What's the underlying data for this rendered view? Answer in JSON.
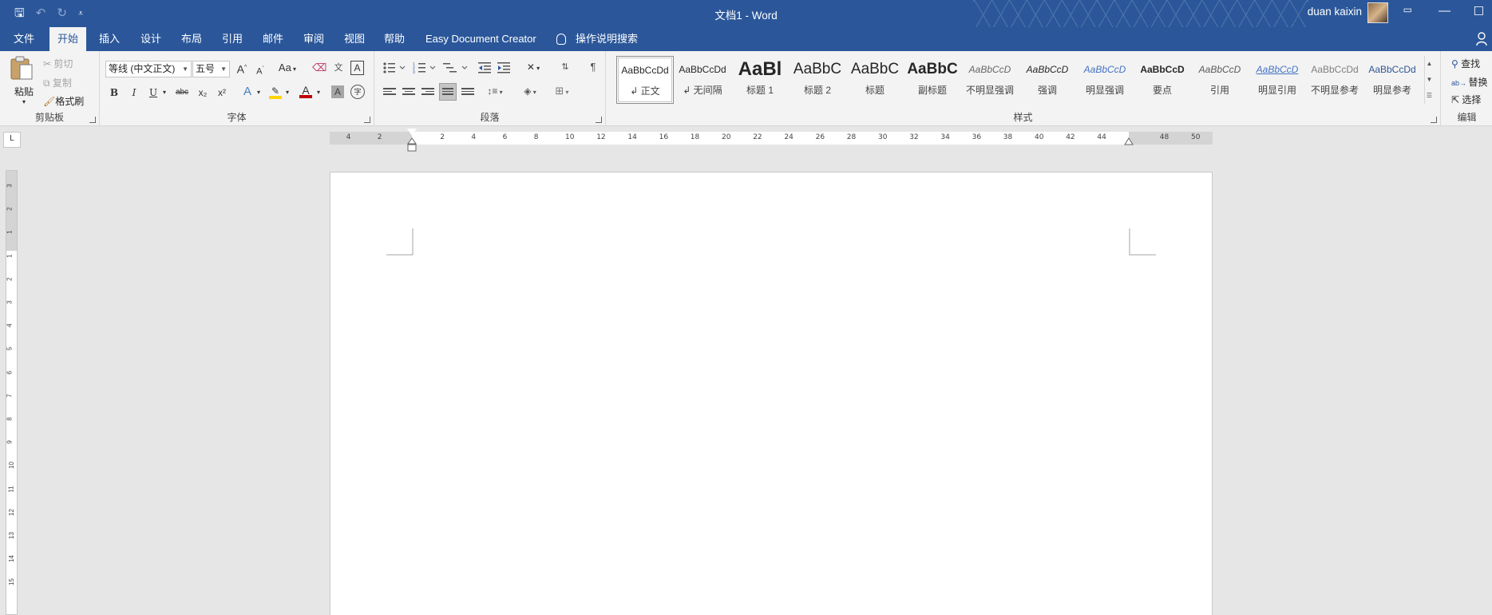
{
  "window": {
    "title": "文档1  -  Word",
    "user": "duan kaixin"
  },
  "quick_access": {
    "save": "🖫",
    "undo": "↶",
    "redo": "↻",
    "customize": "⩡"
  },
  "tabs": [
    {
      "label": "文件"
    },
    {
      "label": "开始"
    },
    {
      "label": "插入"
    },
    {
      "label": "设计"
    },
    {
      "label": "布局"
    },
    {
      "label": "引用"
    },
    {
      "label": "邮件"
    },
    {
      "label": "审阅"
    },
    {
      "label": "视图"
    },
    {
      "label": "帮助"
    },
    {
      "label": "Easy Document Creator"
    }
  ],
  "tell_me": "操作说明搜索",
  "clipboard": {
    "paste": "粘贴",
    "cut": "剪切",
    "copy": "复制",
    "format_painter": "格式刷",
    "group_label": "剪贴板"
  },
  "font": {
    "family": "等线 (中文正文)",
    "size": "五号",
    "group_label": "字体",
    "grow": "A",
    "shrink": "A",
    "case": "Aa",
    "bold": "B",
    "italic": "I",
    "underline": "U",
    "strike": "abc",
    "subscript": "x₂",
    "superscript": "x²",
    "phonetic": "文",
    "char_border": "A",
    "char_shading": "A",
    "enclose": "字"
  },
  "paragraph": {
    "group_label": "段落"
  },
  "styles": {
    "group_label": "样式",
    "items": [
      {
        "sample": "AaBbCcDd",
        "name": "↲ 正文"
      },
      {
        "sample": "AaBbCcDd",
        "name": "↲ 无间隔"
      },
      {
        "sample": "AaBl",
        "name": "标题 1"
      },
      {
        "sample": "AaBbC",
        "name": "标题 2"
      },
      {
        "sample": "AaBbC",
        "name": "标题"
      },
      {
        "sample": "AaBbC",
        "name": "副标题"
      },
      {
        "sample": "AaBbCcD",
        "name": "不明显强调"
      },
      {
        "sample": "AaBbCcD",
        "name": "强调"
      },
      {
        "sample": "AaBbCcD",
        "name": "明显强调"
      },
      {
        "sample": "AaBbCcD",
        "name": "要点"
      },
      {
        "sample": "AaBbCcD",
        "name": "引用"
      },
      {
        "sample": "AaBbCcD",
        "name": "明显引用"
      },
      {
        "sample": "AaBbCcDd",
        "name": "不明显参考"
      },
      {
        "sample": "AaBbCcDd",
        "name": "明显参考"
      }
    ]
  },
  "editing": {
    "find": "查找",
    "replace": "替换",
    "select": "选择",
    "group_label": "编辑"
  },
  "ruler": {
    "corner": "L",
    "h_ticks": [
      "4",
      "2",
      "2",
      "4",
      "6",
      "8",
      "10",
      "12",
      "14",
      "16",
      "18",
      "20",
      "22",
      "24",
      "26",
      "28",
      "30",
      "32",
      "34",
      "36",
      "38",
      "40",
      "42",
      "44",
      "48",
      "50"
    ],
    "v_ticks": [
      "3",
      "2",
      "1",
      "1",
      "2",
      "3",
      "4",
      "5",
      "6",
      "7",
      "8",
      "9",
      "10",
      "11",
      "12",
      "13",
      "14",
      "15"
    ]
  },
  "colors": {
    "brand": "#2b579a",
    "ribbon": "#f3f3f3",
    "workspace": "#e6e6e6",
    "highlight": "#ffd400",
    "font_color": "#c00000"
  }
}
